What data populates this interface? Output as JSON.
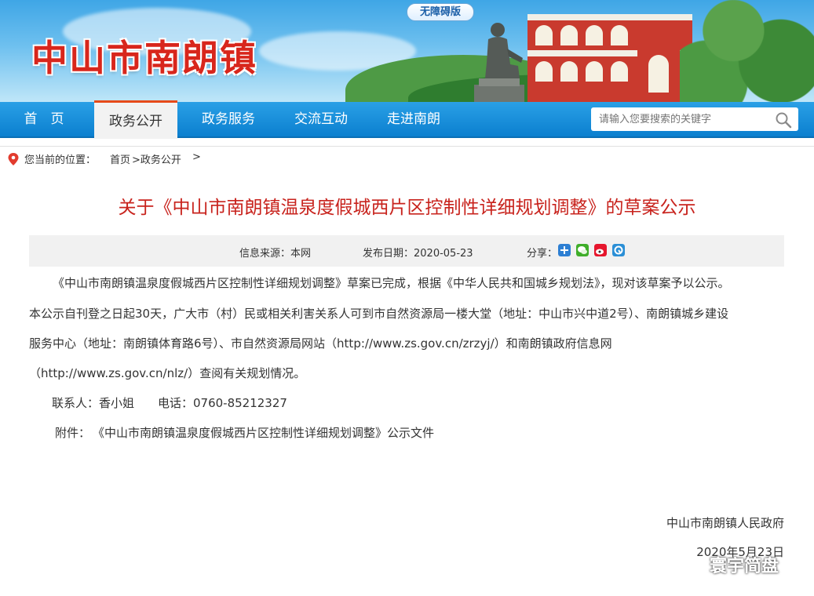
{
  "header": {
    "site_title": "中山市南朗镇",
    "accessibility_label": "无障碍版"
  },
  "nav": {
    "items": [
      {
        "label": "首　页"
      },
      {
        "label": "政务公开"
      },
      {
        "label": "政务服务"
      },
      {
        "label": "交流互动"
      },
      {
        "label": "走进南朗"
      }
    ],
    "search_placeholder": "请输入您要搜索的关键字"
  },
  "breadcrumb": {
    "prefix": "您当前的位置：",
    "home": "首页",
    "section": ">政务公开",
    "tail": ">"
  },
  "article": {
    "title": "关于《中山市南朗镇温泉度假城西片区控制性详细规划调整》的草案公示",
    "source": "信息来源：本网",
    "date": "发布日期：2020-05-23",
    "share_label": "分享：",
    "paragraph": "《中山市南朗镇温泉度假城西片区控制性详细规划调整》草案已完成，根据《中华人民共和国城乡规划法》，现对该草案予以公示。本公示自刊登之日起30天，广大市（村）民或相关利害关系人可到市自然资源局一楼大堂（地址：中山市兴中道2号）、南朗镇城乡建设服务中心（地址：南朗镇体育路6号）、市自然资源局网站（http://www.zs.gov.cn/zrzyj/）和南朗镇政府信息网（http://www.zs.gov.cn/nlz/）查阅有关规划情况。",
    "line1": "《中山市南朗镇温泉度假城西片区控制性详细规划调整》草案已完成，根据《中华人民共和国城乡规划法》，现对该草案予以公示。",
    "line2": "本公示自刊登之日起30天，广大市（村）民或相关利害关系人可到市自然资源局一楼大堂（地址：中山市兴中道2号）、南朗镇城乡建设",
    "line3": "服务中心（地址：南朗镇体育路6号）、市自然资源局网站（http://www.zs.gov.cn/zrzyj/）和南朗镇政府信息网",
    "line4": "（http://www.zs.gov.cn/nlz/）查阅有关规划情况。",
    "contact": "联系人：香小姐　　电话：0760-85212327",
    "attachment_label": "附件：",
    "attachment_link": "《中山市南朗镇温泉度假城西片区控制性详细规划调整》公示文件",
    "signer": "中山市南朗镇人民政府",
    "sign_date": "2020年5月23日"
  },
  "watermark": "寰宇简盘",
  "colors": {
    "title_red": "#c8231d",
    "nav_blue": "#0b7fcf",
    "active_accent": "#e64a19"
  }
}
